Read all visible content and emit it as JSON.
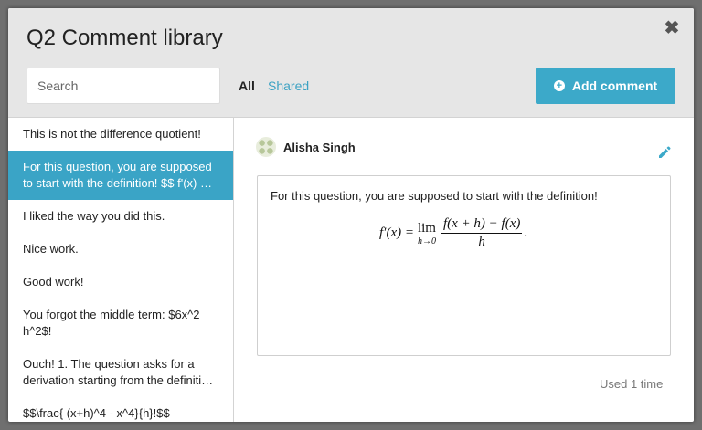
{
  "modal": {
    "title": "Q2 Comment library",
    "close_symbol": "✖"
  },
  "toolbar": {
    "search_placeholder": "Search",
    "filter_all": "All",
    "filter_shared": "Shared",
    "add_label": "Add comment",
    "add_icon": "plus-circle-icon"
  },
  "comments": [
    {
      "text": "This is not the difference quotient!",
      "active": false
    },
    {
      "text": "For this question, you are supposed to start with the definition! $$ f'(x) …",
      "active": true
    },
    {
      "text": "I liked the way you did this.",
      "active": false
    },
    {
      "text": "Nice work.",
      "active": false
    },
    {
      "text": "Good work!",
      "active": false
    },
    {
      "text": "You forgot the middle term: $6x^2 h^2$!",
      "active": false
    },
    {
      "text": "Ouch! 1. The question asks for a derivation starting from the definiti…",
      "active": false
    },
    {
      "text": "$$\\frac{ (x+h)^4 - x^4}{h}!$$",
      "active": false
    }
  ],
  "detail": {
    "author": "Alisha Singh",
    "text": "For this question, you are supposed to start with the definition!",
    "formula": {
      "lhs": "f′(x) =",
      "lim": "lim",
      "lim_sub": "h→0",
      "numerator": "f(x + h) − f(x)",
      "denominator": "h",
      "tail": "."
    },
    "usage": "Used 1 time"
  },
  "colors": {
    "accent": "#3ca9c9",
    "selected_row": "#3aa4c6",
    "header_bg": "#e6e6e6"
  }
}
